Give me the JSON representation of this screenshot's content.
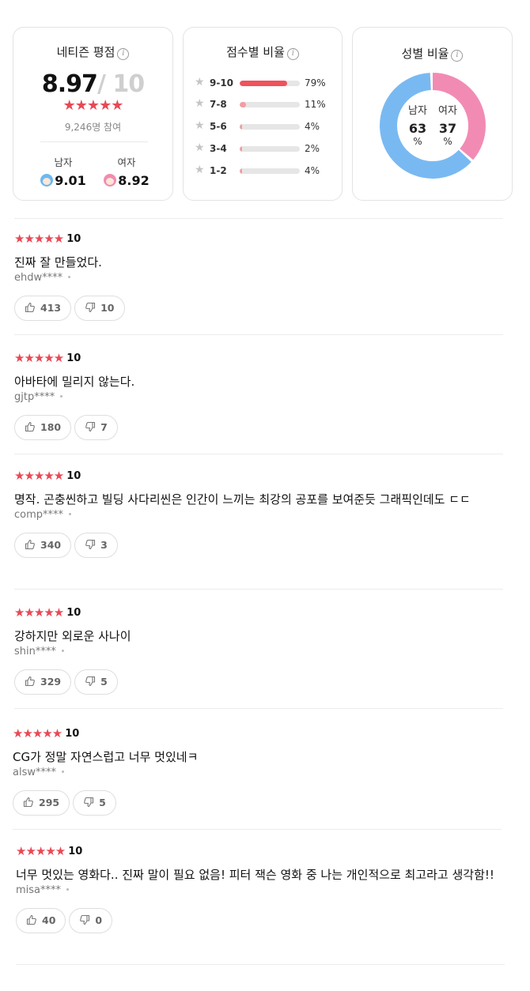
{
  "netizen": {
    "title": "네티즌 평점",
    "info_icon": "info-icon",
    "score": "8.97",
    "score_max": "/ 10",
    "stars": "★★★★★",
    "participants": "9,246명 참여",
    "male": {
      "label": "남자",
      "score": "9.01",
      "icon": "male-face-icon"
    },
    "female": {
      "label": "여자",
      "score": "8.92",
      "icon": "female-face-icon"
    }
  },
  "distribution": {
    "title": "점수별 비율",
    "rows": [
      {
        "label": "9-10",
        "pct_text": "79%",
        "value": 79,
        "color": "#f0525b"
      },
      {
        "label": "7-8",
        "pct_text": "11%",
        "value": 11,
        "color": "#f29ea3"
      },
      {
        "label": "5-6",
        "pct_text": "4%",
        "value": 4,
        "color": "#f29ea3"
      },
      {
        "label": "3-4",
        "pct_text": "2%",
        "value": 2,
        "color": "#f29ea3"
      },
      {
        "label": "1-2",
        "pct_text": "4%",
        "value": 4,
        "color": "#f29ea3"
      }
    ]
  },
  "gender": {
    "title": "성별 비율",
    "male_label": "남자",
    "female_label": "여자",
    "male_value": "63",
    "female_value": "37",
    "unit": "%",
    "male_color": "#79b9f2",
    "female_color": "#f28bb4"
  },
  "reviews": [
    {
      "stars": "★★★★★",
      "score": "10",
      "text": "진짜 잘 만들었다.",
      "author": "ehdw****",
      "likes": "413",
      "dislikes": "10"
    },
    {
      "stars": "★★★★★",
      "score": "10",
      "text": "아바타에 밀리지 않는다.",
      "author": "gjtp****",
      "likes": "180",
      "dislikes": "7"
    },
    {
      "stars": "★★★★★",
      "score": "10",
      "text": "명작. 곤충씬하고 빌딩 사다리씬은 인간이 느끼는 최강의 공포를 보여준듯 그래픽인데도 ㄷㄷ",
      "author": "comp****",
      "likes": "340",
      "dislikes": "3"
    },
    {
      "stars": "★★★★★",
      "score": "10",
      "text": "강하지만 외로운 사나이",
      "author": "shin****",
      "likes": "329",
      "dislikes": "5"
    },
    {
      "stars": "★★★★★",
      "score": "10",
      "text": "CG가 정말 자연스럽고 너무 멋있네ㅋ",
      "author": "alsw****",
      "likes": "295",
      "dislikes": "5"
    },
    {
      "stars": "★★★★★",
      "score": "10",
      "text": "너무 멋있는 영화다.. 진짜 말이 필요 없음! 피터 잭슨 영화 중 나는 개인적으로 최고라고 생각함!!",
      "author": "misa****",
      "likes": "40",
      "dislikes": "0"
    }
  ]
}
